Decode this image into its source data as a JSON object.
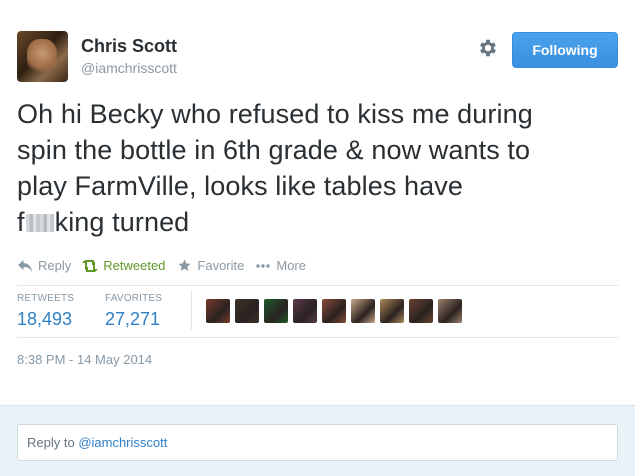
{
  "user": {
    "name": "Chris Scott",
    "handle": "@iamchrisscott",
    "avatar_icon": "user-avatar"
  },
  "header": {
    "settings_icon": "gear-icon",
    "follow_label": "Following"
  },
  "tweet": {
    "line1": "Oh hi Becky who refused to kiss me during",
    "line2": "spin the bottle in 6th grade & now wants to",
    "line3": "play FarmVille, looks like tables have",
    "line4_start": "f",
    "line4_end": "king turned"
  },
  "actions": [
    {
      "label": "Reply",
      "icon": "reply-icon"
    },
    {
      "label": "Retweeted",
      "icon": "retweet-icon",
      "active": true,
      "color": "#609928"
    },
    {
      "label": "Favorite",
      "icon": "star-icon"
    },
    {
      "label": "More",
      "icon": "more-icon"
    }
  ],
  "stats": {
    "retweets_label": "RETWEETS",
    "retweets_value": "18,493",
    "favorites_label": "FAVORITES",
    "favorites_value": "27,271"
  },
  "favoriters": [
    {
      "icon": "user-avatar",
      "color": "#7a3b2c"
    },
    {
      "icon": "user-avatar",
      "color": "#3b3228"
    },
    {
      "icon": "user-avatar",
      "color": "#1f5a2b"
    },
    {
      "icon": "user-avatar",
      "color": "#5a3a4e"
    },
    {
      "icon": "user-avatar",
      "color": "#8a4a3a"
    },
    {
      "icon": "user-avatar",
      "color": "#caa78a"
    },
    {
      "icon": "user-avatar",
      "color": "#b08a5a"
    },
    {
      "icon": "user-avatar",
      "color": "#6a4332"
    },
    {
      "icon": "user-avatar",
      "color": "#9c7f6a"
    }
  ],
  "timestamp": "8:38 PM - 14 May 2014",
  "reply": {
    "prefix": "Reply to ",
    "mention": "@iamchrisscott"
  },
  "colors": {
    "accent": "#2f7fc7",
    "button": "#4aa3ec",
    "muted": "#8899a6",
    "reply_bg": "#e9f2f6"
  }
}
